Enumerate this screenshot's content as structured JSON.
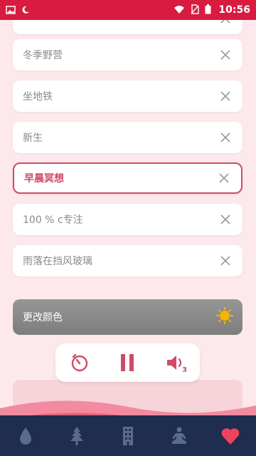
{
  "status_bar": {
    "time": "10:56"
  },
  "sounds": [
    {
      "label": "冬季野营"
    },
    {
      "label": "坐地铁"
    },
    {
      "label": "新生"
    },
    {
      "label": "早晨冥想"
    },
    {
      "label": "100 % c专注"
    },
    {
      "label": "雨落在挡风玻璃"
    }
  ],
  "active_sound_index": 3,
  "color_button": {
    "label": "更改颜色"
  },
  "controls": {
    "volume_level": "3"
  },
  "bottom_nav": [
    "drop-icon",
    "tree-icon",
    "building-icon",
    "meditation-icon",
    "heart-icon"
  ],
  "colors": {
    "status_bar": "#d81b3f",
    "accent": "#d04a66",
    "background": "#fde9ec",
    "nav_background": "#1f2d4e",
    "nav_icon": "#5a6b8c",
    "nav_active": "#f0425f",
    "sun": "#f5b400"
  }
}
